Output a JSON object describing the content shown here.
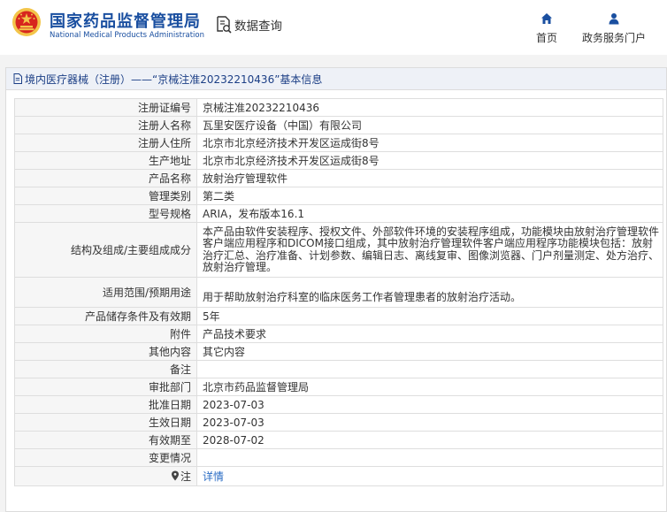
{
  "header": {
    "logo_title": "国家药品监督管理局",
    "logo_subtitle": "National Medical Products Administration",
    "query_label": "数据查询",
    "nav": [
      {
        "label": "首页",
        "icon": "home-icon"
      },
      {
        "label": "政务服务门户",
        "icon": "user-icon"
      }
    ]
  },
  "panel": {
    "title": "境内医疗器械（注册）——“京械注准20232210436”基本信息"
  },
  "rows": [
    {
      "key": "注册证编号",
      "value": "京械注准20232210436"
    },
    {
      "key": "注册人名称",
      "value": "瓦里安医疗设备（中国）有限公司"
    },
    {
      "key": "注册人住所",
      "value": "北京市北京经济技术开发区运成街8号"
    },
    {
      "key": "生产地址",
      "value": "北京市北京经济技术开发区运成街8号"
    },
    {
      "key": "产品名称",
      "value": "放射治疗管理软件"
    },
    {
      "key": "管理类别",
      "value": "第二类"
    },
    {
      "key": "型号规格",
      "value": "ARIA，发布版本16.1"
    },
    {
      "key": "结构及组成/主要组成成分",
      "value": "本产品由软件安装程序、授权文件、外部软件环境的安装程序组成，功能模块由放射治疗管理软件客户端应用程序和DICOM接口组成，其中放射治疗管理软件客户端应用程序功能模块包括：放射治疗汇总、治疗准备、计划参数、编辑日志、离线复审、图像浏览器、门户剂量测定、处方治疗、放射治疗管理。"
    },
    {
      "key": "适用范围/预期用途",
      "value": "用于帮助放射治疗科室的临床医务工作者管理患者的放射治疗活动。"
    },
    {
      "key": "产品储存条件及有效期",
      "value": "5年"
    },
    {
      "key": "附件",
      "value": "产品技术要求"
    },
    {
      "key": "其他内容",
      "value": "其它内容"
    },
    {
      "key": "备注",
      "value": ""
    },
    {
      "key": "审批部门",
      "value": "北京市药品监督管理局"
    },
    {
      "key": "批准日期",
      "value": "2023-07-03"
    },
    {
      "key": "生效日期",
      "value": "2023-07-03"
    },
    {
      "key": "有效期至",
      "value": "2028-07-02"
    },
    {
      "key": "变更情况",
      "value": ""
    },
    {
      "key": "注",
      "value": "详情"
    }
  ],
  "colors": {
    "brand_blue": "#1a4fa0",
    "link_blue": "#2a6cc4",
    "emblem_red": "#d7261e",
    "emblem_gold": "#f3c54a"
  }
}
